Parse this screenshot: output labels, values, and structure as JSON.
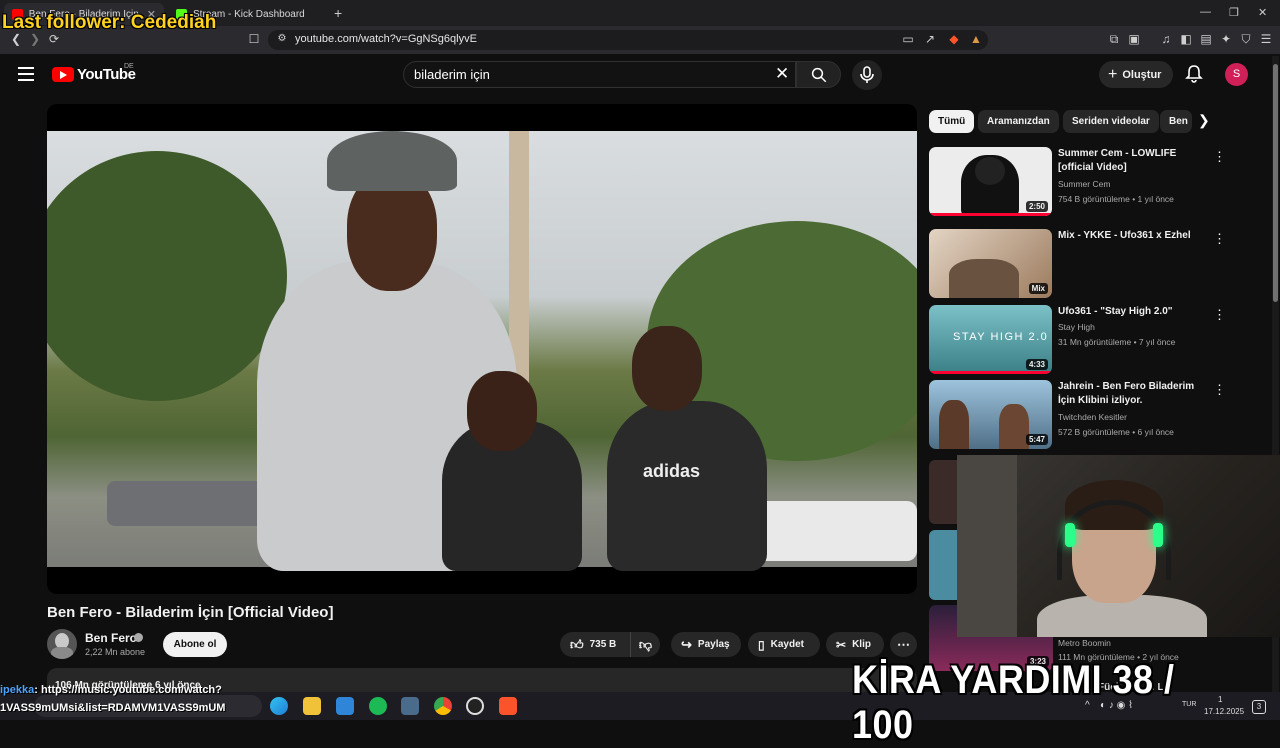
{
  "browser": {
    "tabs": [
      {
        "title": "Ben Fero - Biladerim İçin [Offi",
        "active": true
      },
      {
        "title": "Stream - Kick Dashboard",
        "active": false
      }
    ],
    "url": "youtube.com/watch?v=GgNSg6qlyvE"
  },
  "youtube": {
    "logo_text": "YouTube",
    "country_code": "DE",
    "search_query": "biladerim için",
    "create_label": "Oluştur",
    "avatar_letter": "S"
  },
  "video": {
    "title": "Ben Fero - Biladerim İçin [Official Video]",
    "channel": "Ben Fero",
    "subscribers": "2,22 Mn abone",
    "subscribe_label": "Abone ol",
    "likes": "735 B",
    "share_label": "Paylaş",
    "save_label": "Kaydet",
    "clip_label": "Klip",
    "views_line": "106 Mn görüntüleme  6 yıl önce"
  },
  "sidebar": {
    "chips": [
      "Tümü",
      "Aramanızdan",
      "Seriden videolar",
      "Ben"
    ],
    "recommendations": [
      {
        "title": "Summer Cem - LOWLIFE [official Video]",
        "channel": "Summer Cem",
        "verified": true,
        "meta": "754 B görüntüleme • 1 yıl önce",
        "badge": "2:50",
        "thumb_color": "#e9e9e9"
      },
      {
        "title": "Mix - YKKE - Ufo361 x Ezhel",
        "channel": "",
        "verified": false,
        "meta": "",
        "badge": "Mix",
        "thumb_color": "#cbb6a3"
      },
      {
        "title": "Ufo361 - \"Stay High 2.0\"",
        "channel": "Stay High",
        "verified": true,
        "meta": "31 Mn görüntüleme • 7 yıl önce",
        "badge": "4:33",
        "thumb_color": "#5fa0a8",
        "thumb_text": "STAY HIGH 2.0"
      },
      {
        "title": "Jahrein - Ben Fero Biladerim İçin Klibini izliyor.",
        "channel": "Twitchden Kesitler",
        "verified": false,
        "meta": "572 B görüntüleme • 6 yıl önce",
        "badge": "5:47",
        "thumb_color": "#6b8fa7"
      }
    ],
    "partial_rec": {
      "channel": "Metro Boomin",
      "meta": "111 Mn görüntüleme • 2 yıl önce",
      "badge": "3:23",
      "title_fragment": "Fück Di... ft. L..."
    }
  },
  "overlays": {
    "last_follower": "Last follower: Cedediah",
    "rent_goal": "KİRA YARDIMI 38 / 100",
    "chat_user": "ipekka",
    "chat_message": ": https://music.youtube.com/watch?",
    "chat_message_2": "1VASS9mUMsi&list=RDAMVM1VASS9mUM"
  },
  "taskbar": {
    "tray_lang": "TUR",
    "time": "1",
    "date": "17.12.2025",
    "notifications": "3"
  }
}
